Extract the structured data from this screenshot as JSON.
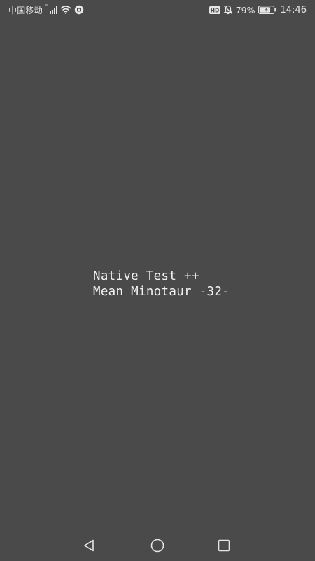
{
  "status_bar": {
    "carrier": "中国移动",
    "signal_tag": "4G",
    "wifi_icon": "wifi-icon",
    "circle_badge_icon": "circle-badge-icon",
    "hd_label": "HD",
    "bell_icon": "bell-muted-icon",
    "battery_percent": "79%",
    "battery_level": 0.79,
    "time": "14:46"
  },
  "main": {
    "line1": "Native Test ++",
    "line2": "Mean Minotaur -32-"
  },
  "nav_bar": {
    "back_icon": "back-triangle-icon",
    "home_icon": "home-circle-icon",
    "recent_icon": "recent-square-icon"
  },
  "colors": {
    "background": "#4a4a4a",
    "text": "#f2f2f2",
    "status": "#e6e6e6"
  }
}
